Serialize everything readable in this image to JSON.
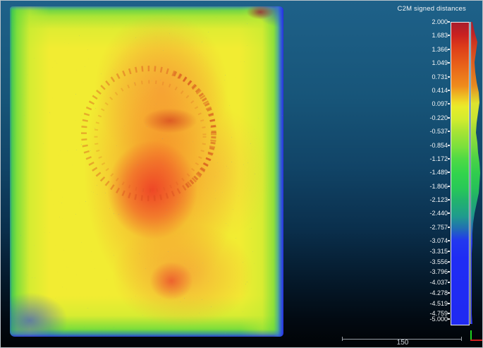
{
  "colorbar": {
    "title": "C2M signed distances",
    "ticks": [
      "2.000",
      "1.683",
      "1.366",
      "1.049",
      "0.731",
      "0.414",
      "0.097",
      "-0.220",
      "-0.537",
      "-0.854",
      "-1.172",
      "-1.489",
      "-1.806",
      "-2.123",
      "-2.440",
      "-2.757",
      "-3.074",
      "-3.315",
      "-3.556",
      "-3.796",
      "-4.037",
      "-4.278",
      "-4.519",
      "-4.759",
      "-5.000"
    ],
    "max": 2.0,
    "min": -5.0,
    "histogram_widths": [
      2,
      5,
      9,
      7,
      5,
      6,
      8,
      11,
      12,
      10,
      8,
      7,
      9,
      10,
      12,
      13,
      12,
      11,
      8,
      5,
      3,
      2,
      2,
      1,
      1,
      1,
      1,
      1,
      1,
      1,
      2
    ]
  },
  "scalebar": {
    "label": "150"
  },
  "gizmo": {
    "vertical_axis_color": "#1fd41f",
    "horizontal_axis_color": "#cf2020"
  },
  "colors": {
    "background_top": "#1e6189",
    "background_bottom": "#010305",
    "scale_red": "#d92b1d",
    "scale_orange": "#ef8c1c",
    "scale_yellow": "#e8ec2a",
    "scale_green": "#32d44c",
    "scale_blue": "#1f2af2"
  },
  "chart_data": {
    "type": "heatmap",
    "title": "C2M signed distances",
    "legend_position": "right",
    "colorbar_range": [
      -5.0,
      2.0
    ],
    "colorbar_ticks": [
      2.0,
      1.683,
      1.366,
      1.049,
      0.731,
      0.414,
      0.097,
      -0.22,
      -0.537,
      -0.854,
      -1.172,
      -1.489,
      -1.806,
      -2.123,
      -2.44,
      -2.757,
      -3.074,
      -3.315,
      -3.556,
      -3.796,
      -4.037,
      -4.278,
      -4.519,
      -4.759,
      -5.0
    ],
    "colormap": [
      "blue",
      "green",
      "yellow",
      "red"
    ],
    "scale_bar_length": 150,
    "histogram": {
      "orientation": "vertical-right-of-colorbar",
      "relative_counts_top_to_bottom": [
        2,
        5,
        9,
        7,
        5,
        6,
        8,
        11,
        12,
        10,
        8,
        7,
        9,
        10,
        12,
        13,
        12,
        11,
        8,
        5,
        3,
        2,
        2,
        1,
        1,
        1,
        1,
        1,
        1,
        1,
        2
      ]
    },
    "regions": [
      {
        "area": "central core blob",
        "approx_value": 1.5,
        "color": "red"
      },
      {
        "area": "central vertical column and lower blob",
        "approx_value": 0.7,
        "color": "orange"
      },
      {
        "area": "main surface interior",
        "approx_value": 0.0,
        "color": "yellow"
      },
      {
        "area": "outer margins",
        "approx_value": -1.5,
        "color": "green"
      },
      {
        "area": "extreme edges / right and bottom fringe",
        "approx_value": -4.0,
        "color": "blue"
      },
      {
        "area": "dotted ring pattern upper half",
        "approx_value": 1.0,
        "color": "red-orange"
      }
    ]
  }
}
